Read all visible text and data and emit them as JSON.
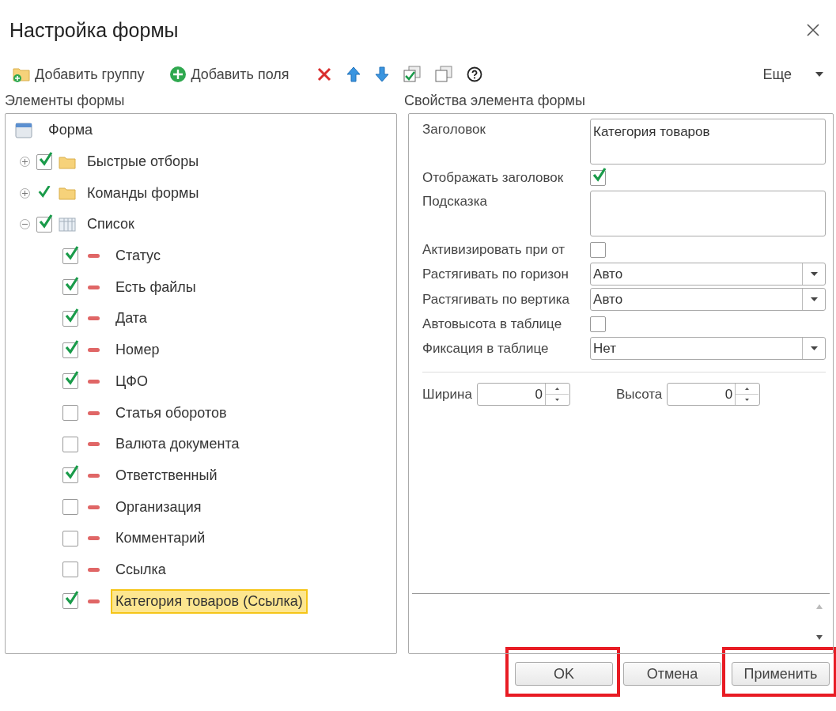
{
  "window": {
    "title": "Настройка формы"
  },
  "toolbar": {
    "items": [
      {
        "kind": "add-group",
        "label": "Добавить группу"
      },
      {
        "kind": "add-field",
        "label": "Добавить поля"
      },
      {
        "kind": "delete"
      },
      {
        "kind": "up"
      },
      {
        "kind": "down"
      },
      {
        "kind": "check-all"
      },
      {
        "kind": "uncheck-all"
      },
      {
        "kind": "help"
      }
    ],
    "more": "Еще"
  },
  "left": {
    "title": "Элементы формы",
    "tree": {
      "label": "Форма",
      "kind": "form",
      "children": [
        {
          "label": "Быстрые отборы",
          "kind": "group",
          "checkbox": {
            "kind": "boxed",
            "checked": true
          },
          "expanded": false,
          "selected": false
        },
        {
          "label": "Команды формы",
          "kind": "group",
          "checkbox": {
            "kind": "plain",
            "checked": true
          },
          "expanded": false,
          "selected": false
        },
        {
          "label": "Список",
          "kind": "table",
          "checkbox": {
            "kind": "boxed",
            "checked": true
          },
          "expanded": true,
          "selected": false,
          "children": [
            {
              "label": "Статус",
              "kind": "field",
              "checked": true,
              "selected": false
            },
            {
              "label": "Есть файлы",
              "kind": "field",
              "checked": true,
              "selected": false
            },
            {
              "label": "Дата",
              "kind": "field",
              "checked": true,
              "selected": false
            },
            {
              "label": "Номер",
              "kind": "field",
              "checked": true,
              "selected": false
            },
            {
              "label": "ЦФО",
              "kind": "field",
              "checked": true,
              "selected": false
            },
            {
              "label": "Статья оборотов",
              "kind": "field",
              "checked": false,
              "selected": false
            },
            {
              "label": "Валюта документа",
              "kind": "field",
              "checked": false,
              "selected": false
            },
            {
              "label": "Ответственный",
              "kind": "field",
              "checked": true,
              "selected": false
            },
            {
              "label": "Организация",
              "kind": "field",
              "checked": false,
              "selected": false
            },
            {
              "label": "Комментарий",
              "kind": "field",
              "checked": false,
              "selected": false
            },
            {
              "label": "Ссылка",
              "kind": "field",
              "checked": false,
              "selected": false
            },
            {
              "label": "Категория товаров (Ссылка)",
              "kind": "field",
              "checked": true,
              "selected": true
            }
          ]
        }
      ]
    }
  },
  "right": {
    "title": "Свойства элемента формы",
    "properties": [
      {
        "kind": "textarea",
        "label": "Заголовок",
        "value": "Категория товаров"
      },
      {
        "kind": "checkbox",
        "label": "Отображать заголовок",
        "checked": true
      },
      {
        "kind": "textarea",
        "label": "Подсказка"
      },
      {
        "kind": "checkbox",
        "label": "Активизировать при от",
        "checked": false
      },
      {
        "kind": "select",
        "label": "Растягивать по горизон",
        "value": "Авто"
      },
      {
        "kind": "select",
        "label": "Растягивать по вертика",
        "value": "Авто"
      },
      {
        "kind": "checkbox",
        "label": "Автовысота в таблице",
        "checked": false
      },
      {
        "kind": "select",
        "label": "Фиксация в таблице",
        "value": "Нет"
      }
    ],
    "sizes": [
      {
        "label": "Ширина",
        "value": "0"
      },
      {
        "label": "Высота",
        "value": "0"
      }
    ]
  },
  "buttons": [
    {
      "label": "OK",
      "highlighted": true
    },
    {
      "label": "Отмена",
      "highlighted": false
    },
    {
      "label": "Применить",
      "highlighted": true
    }
  ]
}
